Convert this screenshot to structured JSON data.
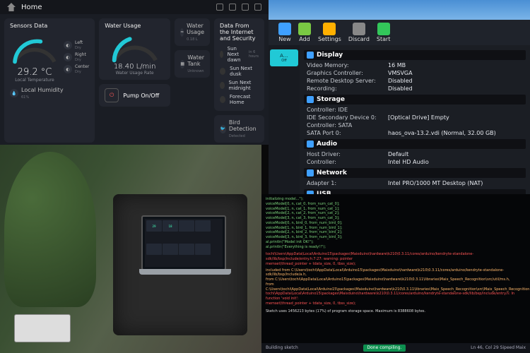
{
  "dashboard": {
    "title": "Home",
    "cards": {
      "sensors": {
        "heading": "Sensors Data",
        "temp_value": "29.2 °C",
        "temp_label": "Local Temperature",
        "side": [
          {
            "label": "Left",
            "sub": "Dry"
          },
          {
            "label": "Right",
            "sub": "Dry"
          },
          {
            "label": "Center",
            "sub": "Dry"
          }
        ],
        "humidity": {
          "label": "Local Humidity",
          "value": "61%"
        }
      },
      "water": {
        "heading": "Water Usage",
        "rate_value": "18.40 L/min",
        "rate_label": "Water Usage Rate",
        "pump_label": "Pump On/Off",
        "usage": {
          "label": "Water Usage",
          "value": "0.18 L"
        },
        "tank": {
          "label": "Water Tank",
          "value": "Unknown"
        }
      },
      "internet": {
        "heading": "Data From the Internet and Security",
        "rows": [
          "Sun Next dawn",
          "Sun Next dusk",
          "Sun Next midnight",
          "Forecast Home"
        ],
        "time": "in 6 hours",
        "bird": {
          "label": "Bird Detection",
          "value": "Detected"
        }
      }
    }
  },
  "vbox": {
    "tools": [
      {
        "n": "New"
      },
      {
        "n": "Add"
      },
      {
        "n": "Settings"
      },
      {
        "n": "Discard"
      },
      {
        "n": "Start"
      }
    ],
    "selected": {
      "name": "A…",
      "state": "Off"
    },
    "sections": {
      "display": {
        "title": "Display",
        "rows": [
          [
            "Video Memory:",
            "16 MB"
          ],
          [
            "Graphics Controller:",
            "VMSVGA"
          ],
          [
            "Remote Desktop Server:",
            "Disabled"
          ],
          [
            "Recording:",
            "Disabled"
          ]
        ]
      },
      "storage": {
        "title": "Storage",
        "rows": [
          [
            "Controller: IDE",
            ""
          ],
          [
            "IDE Secondary Device 0:",
            "[Optical Drive] Empty"
          ],
          [
            "Controller: SATA",
            ""
          ],
          [
            "SATA Port 0:",
            "haos_ova-13.2.vdi (Normal, 32.00 GB)"
          ]
        ]
      },
      "audio": {
        "title": "Audio",
        "rows": [
          [
            "Host Driver:",
            "Default"
          ],
          [
            "Controller:",
            "Intel HD Audio"
          ]
        ]
      },
      "network": {
        "title": "Network",
        "rows": [
          [
            "Adapter 1:",
            "Intel PRO/1000 MT Desktop (NAT)"
          ]
        ]
      },
      "usb": {
        "title": "USB"
      }
    }
  },
  "terminal": {
    "init": "initializing model...\");",
    "models": [
      "voiceModel[0, n, cat_0, from_num_cat_0];",
      "voiceModel[1, n, cat_1, from_num_cat_1];",
      "voiceModel[2, n, cat_2, from_num_cat_2];",
      "voiceModel[3, n, cat_3, from_num_cat_3];",
      "voiceModel[0, n, bird_0, from_num_bird_0];",
      "voiceModel[1, n, bird_1, from_num_bird_1];",
      "voiceModel[2, n, bird_2, from_num_bird_2];",
      "voiceModel[3, n, bird_3, from_num_bird_3];"
    ],
    "println1": "al.println(\"Model init OK!\");",
    "println2": "al.println(\"Everything is ready!!\");",
    "warn": "tochi\\Users\\AppData\\Local\\Arduino15\\packages\\Maixduino\\hardware\\k210\\0.3.11/cores/arduino/kendryte-standalone-sdk/lib/bsp/include/entry.h:7:27: warning: pointer",
    "warn2": "memset(thread_pointer + tdata_size, 0, tbss_size);",
    "included": [
      "included from C:\\Users\\tochi\\AppData\\Local\\Arduino15\\packages\\Maixduino\\hardware\\k210\\0.3.11/cores/arduino/kendryte-standalone-sdk/lib/bsp/include/a.h,",
      "         from C:\\Users\\tochi\\AppData\\Local\\Arduino15\\packages\\Maixduino\\hardware\\k210\\0.3.11\\libraries\\Maix_Speech_Recognition\\src/util/ms.h,",
      "         from C:\\Users\\tochi\\AppData\\Local\\Arduino15\\packages\\Maixduino\\hardware\\k210\\0.3.11\\libraries\\Maix_Speech_Recognition\\src\\Maix_Speech_Recognition.cpp:"
    ],
    "warn3": "tochi\\AppData\\Local\\Arduino15\\packages\\Maixduino\\hardware\\k210\\0.3.11/cores/arduino/kendryte-standalone-sdk/lib/bsp/include/entry.h: In function 'void init':",
    "sketch": "Sketch uses 1456213 bytes (17%) of program storage space. Maximum is 8388608 bytes.",
    "status_left": "Building sketch",
    "status_mid": "Ln 46, Col 29   Sipeed Maix",
    "done": "Done compiling."
  }
}
